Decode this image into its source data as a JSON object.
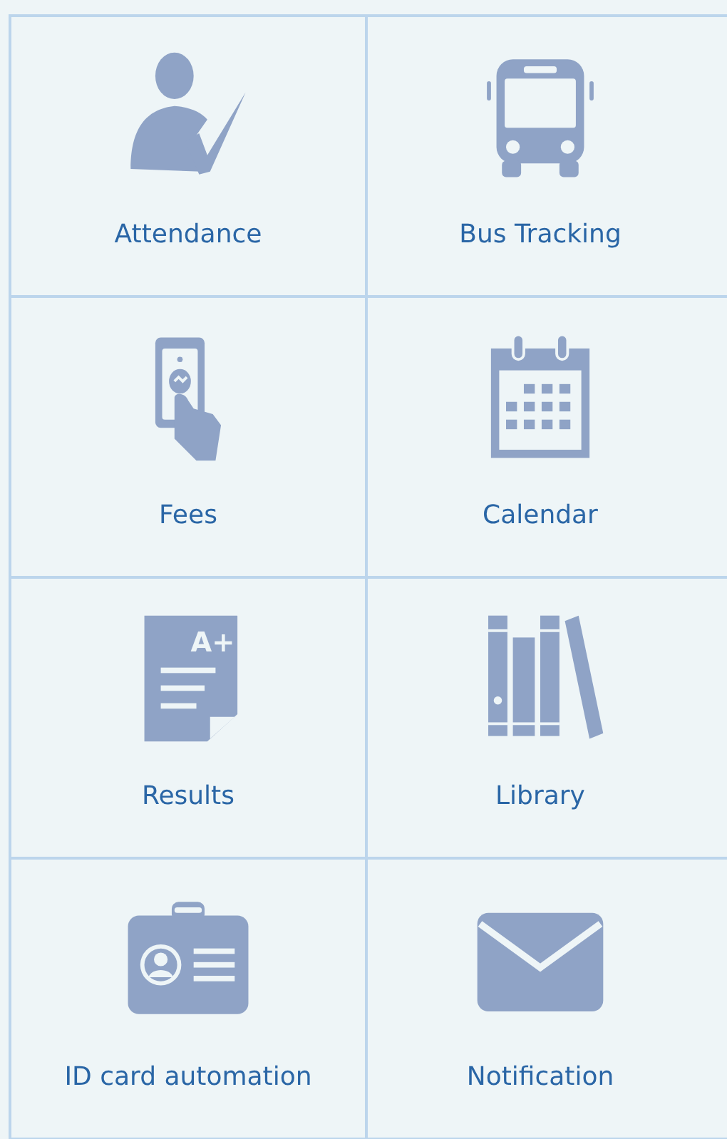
{
  "tiles": [
    {
      "label": "Attendance"
    },
    {
      "label": "Bus Tracking"
    },
    {
      "label": "Fees"
    },
    {
      "label": "Calendar"
    },
    {
      "label": "Results",
      "icon_text": "A+"
    },
    {
      "label": "Library"
    },
    {
      "label": "ID card automation"
    },
    {
      "label": "Notification"
    }
  ]
}
